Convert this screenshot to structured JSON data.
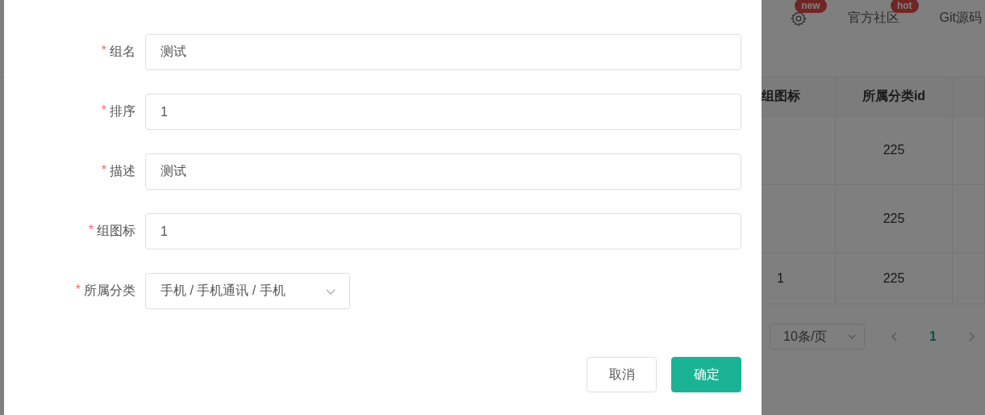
{
  "background": {
    "header": {
      "items": [
        {
          "kind": "icon",
          "badge": "new"
        },
        {
          "kind": "link",
          "label": "官方社区",
          "badge": "hot"
        },
        {
          "kind": "link",
          "label": "Git源码"
        }
      ]
    },
    "table": {
      "columns": [
        "组图标",
        "所属分类id"
      ],
      "rows": [
        [
          "",
          "225"
        ],
        [
          "",
          "225"
        ],
        [
          "1",
          "225"
        ]
      ]
    },
    "pagination": {
      "page_size": "10条/页",
      "pages": [
        {
          "label": "1",
          "selected": true
        }
      ]
    }
  },
  "dialog": {
    "fields": [
      {
        "kind": "input",
        "mark": "*",
        "label": "组名",
        "value": "测试"
      },
      {
        "kind": "input",
        "mark": "*",
        "label": "排序",
        "value": "1"
      },
      {
        "kind": "input",
        "mark": "*",
        "label": "描述",
        "value": "测试"
      },
      {
        "kind": "input",
        "mark": "*",
        "label": "组图标",
        "value": "1"
      },
      {
        "kind": "cascader",
        "mark": "*",
        "label": "所属分类",
        "value": "手机 / 手机通讯 / 手机"
      }
    ],
    "buttons": [
      {
        "label": "取消",
        "primary": false
      },
      {
        "label": "确定",
        "primary": true
      }
    ]
  }
}
